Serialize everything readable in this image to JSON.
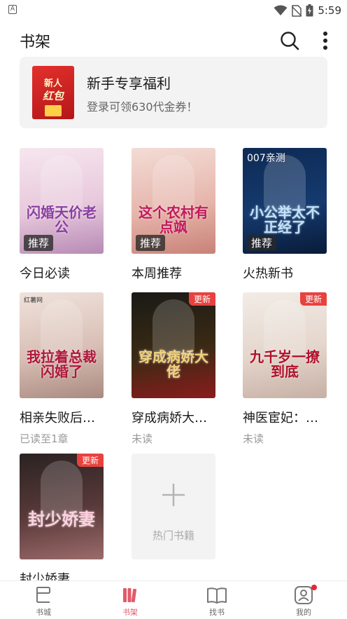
{
  "status_bar": {
    "left_icon_letter": "A",
    "time": "5:59"
  },
  "header": {
    "title": "书架",
    "search_icon": "search-icon",
    "more_icon": "more-vertical-icon"
  },
  "promo": {
    "image_text_line1": "新人",
    "image_text_line2": "红包",
    "title": "新手专享福利",
    "subtitle": "登录可领630代金券！"
  },
  "books": [
    {
      "name": "今日必读",
      "status": "",
      "badge": "推荐",
      "update": "",
      "cover_text": "闪婚天价老公",
      "cover_colors": [
        "#f6e6ef",
        "#e8c9dc",
        "#b78ab5"
      ],
      "title_color": "#8a3fa1"
    },
    {
      "name": "本周推荐",
      "status": "",
      "badge": "推荐",
      "update": "",
      "cover_text": "这个农村有点飒",
      "cover_colors": [
        "#f3dcd6",
        "#e6b6ac",
        "#c98277"
      ],
      "title_color": "#c2185b"
    },
    {
      "name": "火热新书",
      "status": "",
      "badge": "推荐",
      "update": "",
      "cover_top_text": "007亲测",
      "cover_text": "小公举太不正经了",
      "cover_colors": [
        "#0e2a55",
        "#143a6e",
        "#0a1b3a"
      ],
      "title_color": "#bfe3ff"
    },
    {
      "name": "相亲失败后…",
      "status": "已读至1章",
      "badge": "",
      "update": "",
      "cover_top_text": "红薯网",
      "cover_text": "我拉着总裁闪婚了",
      "cover_colors": [
        "#efe2dc",
        "#d9bfb5",
        "#a98a80"
      ],
      "title_color": "#b0173a"
    },
    {
      "name": "穿成病娇大…",
      "status": "未读",
      "badge": "",
      "update": "更新",
      "cover_text": "穿成病娇大佬",
      "cover_colors": [
        "#1a1a16",
        "#3a2a14",
        "#8b1c1c"
      ],
      "title_color": "#f3d27a"
    },
    {
      "name": "神医宦妃：…",
      "status": "未读",
      "badge": "",
      "update": "更新",
      "cover_text": "九千岁一撩到底",
      "cover_colors": [
        "#f2ece6",
        "#e4d6cc",
        "#c7b0a5"
      ],
      "title_color": "#b0102a"
    },
    {
      "name": "封少娇妻",
      "status": "",
      "badge": "",
      "update": "更新",
      "cover_text": "封少娇妻",
      "cover_colors": [
        "#2b2222",
        "#5a3a3a",
        "#9c6b6b"
      ],
      "title_color": "#ffd1e0"
    }
  ],
  "add_card": {
    "label": "热门书籍"
  },
  "bottom_nav": [
    {
      "label": "书城",
      "icon": "bookstore-icon",
      "active": false
    },
    {
      "label": "书架",
      "icon": "bookshelf-icon",
      "active": true
    },
    {
      "label": "找书",
      "icon": "open-book-icon",
      "active": false
    },
    {
      "label": "我的",
      "icon": "profile-icon",
      "active": false,
      "has_dot": true
    }
  ],
  "colors": {
    "accent": "#e35a6a",
    "badge_update": "#e8423f",
    "notification_dot": "#e8233b"
  }
}
